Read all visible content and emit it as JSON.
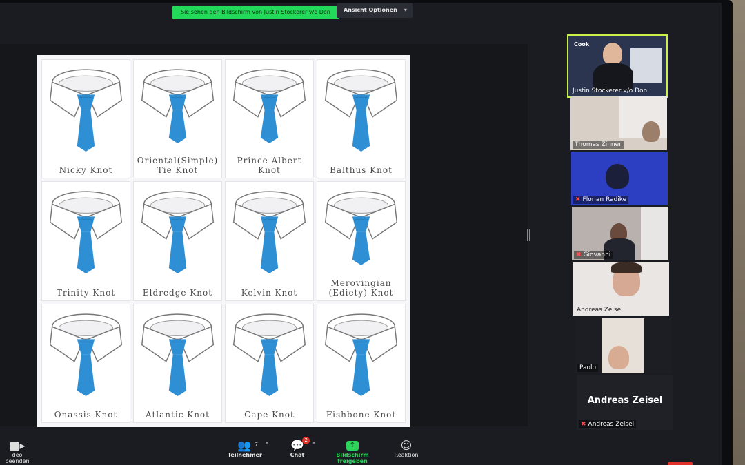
{
  "banner": {
    "sharing_text": "Sie sehen den Bildschirm von Justin Stockerer v/o Don",
    "view_options": "Ansicht Optionen",
    "view_options_icon": "chevron-down-icon"
  },
  "slide": {
    "tie_color": "#2f8fd4",
    "knots": [
      {
        "label": "Nicky Knot"
      },
      {
        "label": "Oriental(Simple)\nTie Knot"
      },
      {
        "label": "Prince Albert\nKnot"
      },
      {
        "label": "Balthus Knot"
      },
      {
        "label": "Trinity Knot"
      },
      {
        "label": "Eldredge Knot"
      },
      {
        "label": "Kelvin Knot"
      },
      {
        "label": "Merovingian\n(Ediety) Knot"
      },
      {
        "label": "Onassis Knot"
      },
      {
        "label": "Atlantic Knot"
      },
      {
        "label": "Cape Knot"
      },
      {
        "label": "Fishbone Knot"
      }
    ]
  },
  "participants": {
    "tiles": [
      {
        "name": "Justin Stockerer v/o Don",
        "muted": false,
        "active": true
      },
      {
        "name": "Thomas Zinner",
        "muted": false
      },
      {
        "name": "Florian Radike",
        "muted": true
      },
      {
        "name": "Giovanni",
        "muted": true
      },
      {
        "name": "Andreas Zeisel",
        "muted": false
      },
      {
        "name": "Paolo",
        "muted": false
      },
      {
        "name": "Andreas Zeisel",
        "muted": true,
        "video_off": true,
        "display_name": "Andreas Zeisel"
      }
    ]
  },
  "toolbar": {
    "video_label": "deo beenden",
    "participants_label": "Teilnehmer",
    "participants_count": "7",
    "chat_label": "Chat",
    "chat_badge": "2",
    "share_label": "Bildschirm freigeben",
    "reactions_label": "Reaktion",
    "video_icon": "video-camera-icon",
    "participants_icon": "people-icon",
    "chat_icon": "chat-bubble-icon",
    "share_icon": "share-arrow-icon",
    "reactions_icon": "smiley-add-icon"
  }
}
